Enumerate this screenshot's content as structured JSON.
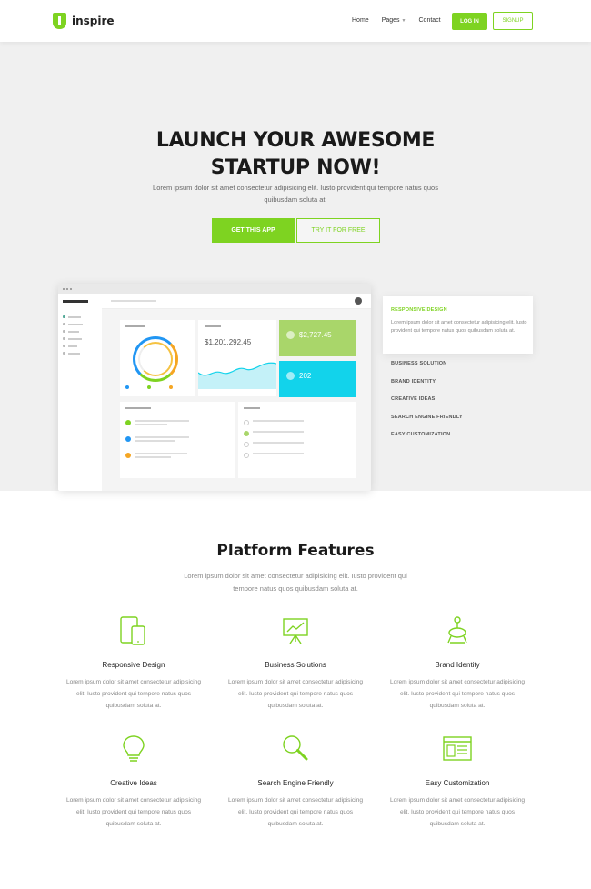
{
  "nav": {
    "logo_text": "inspire",
    "links": [
      "Home",
      "Pages",
      "Contact"
    ],
    "login": "LOG IN",
    "signup": "SIGNUP"
  },
  "hero": {
    "title_line1": "LAUNCH YOUR AWESOME",
    "title_line2": "STARTUP NOW!",
    "subtitle": "Lorem ipsum dolor sit amet consectetur adipisicing elit. Iusto provident qui tempore natus quos quibusdam soluta at.",
    "cta_primary": "GET THIS APP",
    "cta_secondary": "TRY IT FOR FREE",
    "dashboard": {
      "earnings": "$1,201,292.45",
      "green_tile": "$2,727.45",
      "cyan_tile": "202"
    },
    "active_feature": {
      "title": "RESPONSIVE DESIGN",
      "text": "Lorem ipsum dolor sit amet consectetur adipisicing elit. Iusto provident qui tempore natus quos quibusdam soluta at."
    },
    "feature_list": [
      "BUSINESS SOLUTION",
      "BRAND IDENTITY",
      "CREATIVE IDEAS",
      "SEARCH ENGINE FRIENDLY",
      "EASY CUSTOMIZATION"
    ]
  },
  "features": {
    "title": "Platform Features",
    "subtitle": "Lorem ipsum dolor sit amet consectetur adipisicing elit. Iusto provident qui tempore natus quos quibusdam soluta at.",
    "items": [
      {
        "name": "Responsive Design",
        "icon": "devices-icon",
        "text": "Lorem ipsum dolor sit amet consectetur adipisicing elit. Iusto provident qui tempore natus quos quibusdam soluta at."
      },
      {
        "name": "Business Solutions",
        "icon": "presentation-chart-icon",
        "text": "Lorem ipsum dolor sit amet consectetur adipisicing elit. Iusto provident qui tempore natus quos quibusdam soluta at."
      },
      {
        "name": "Brand Identity",
        "icon": "brand-stamp-icon",
        "text": "Lorem ipsum dolor sit amet consectetur adipisicing elit. Iusto provident qui tempore natus quos quibusdam soluta at."
      },
      {
        "name": "Creative Ideas",
        "icon": "lightbulb-icon",
        "text": "Lorem ipsum dolor sit amet consectetur adipisicing elit. Iusto provident qui tempore natus quos quibusdam soluta at."
      },
      {
        "name": "Search Engine Friendly",
        "icon": "magnifier-icon",
        "text": "Lorem ipsum dolor sit amet consectetur adipisicing elit. Iusto provident qui tempore natus quos quibusdam soluta at."
      },
      {
        "name": "Easy Customization",
        "icon": "browser-window-icon",
        "text": "Lorem ipsum dolor sit amet consectetur adipisicing elit. Iusto provident qui tempore natus quos quibusdam soluta at."
      }
    ]
  },
  "colors": {
    "accent": "#7ed321",
    "hero_bg": "#f0f0f0",
    "cyan": "#12d3eb"
  }
}
